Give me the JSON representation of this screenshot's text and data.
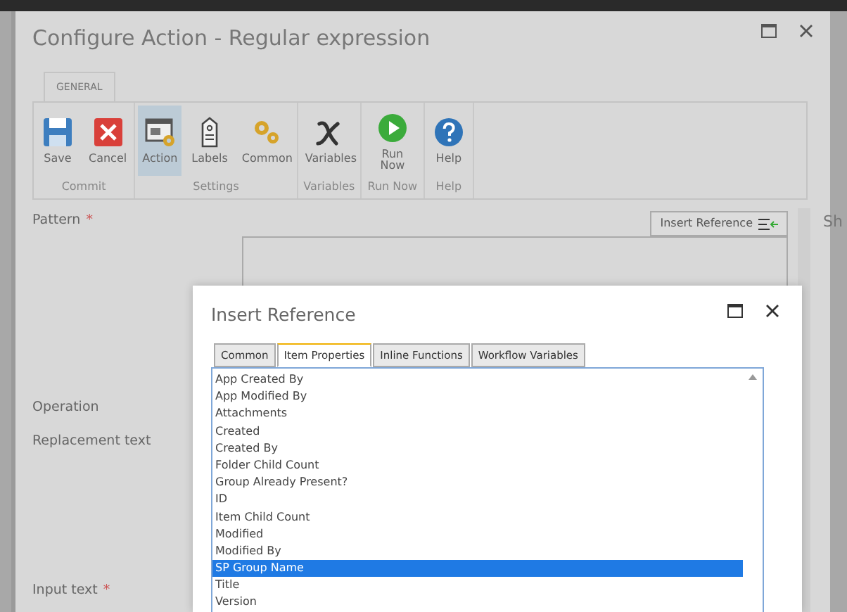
{
  "window": {
    "title": "Configure Action - Regular expression"
  },
  "ribbon": {
    "tabs": [
      {
        "label": "GENERAL",
        "selected": true
      }
    ],
    "groups": [
      {
        "label": "Commit",
        "buttons": [
          {
            "label": "Save",
            "kind": "save",
            "selected": false
          },
          {
            "label": "Cancel",
            "kind": "cancel",
            "selected": false
          }
        ]
      },
      {
        "label": "Settings",
        "buttons": [
          {
            "label": "Action",
            "kind": "action",
            "selected": true
          },
          {
            "label": "Labels",
            "kind": "labels",
            "selected": false
          },
          {
            "label": "Common",
            "kind": "common",
            "selected": false
          }
        ]
      },
      {
        "label": "Variables",
        "buttons": [
          {
            "label": "Variables",
            "kind": "variables",
            "selected": false
          }
        ]
      },
      {
        "label": "Run Now",
        "buttons": [
          {
            "label": "Run Now",
            "kind": "run",
            "selected": false
          }
        ]
      },
      {
        "label": "Help",
        "buttons": [
          {
            "label": "Help",
            "kind": "help",
            "selected": false
          }
        ]
      }
    ]
  },
  "form": {
    "insert_reference_button": "Insert Reference",
    "fields": [
      {
        "label": "Pattern",
        "required_mark": "*",
        "kind": "textarea"
      },
      {
        "label": "Operation",
        "kind": "plain"
      },
      {
        "label": "Replacement text",
        "kind": "plain"
      },
      {
        "label": "Input text",
        "required_mark": "*",
        "kind": "plain"
      }
    ]
  },
  "side_text": "Sh",
  "insert_reference": {
    "title": "Insert Reference",
    "tabs": [
      {
        "label": "Common",
        "selected": false
      },
      {
        "label": "Item Properties",
        "selected": true
      },
      {
        "label": "Inline Functions",
        "selected": false
      },
      {
        "label": "Workflow Variables",
        "selected": false
      }
    ],
    "items": [
      {
        "label": "App Created By",
        "selected": false
      },
      {
        "label": "App Modified By",
        "selected": false
      },
      {
        "label": "Attachments",
        "selected": false
      },
      {
        "label": "Created",
        "selected": false
      },
      {
        "label": "Created By",
        "selected": false
      },
      {
        "label": "Folder Child Count",
        "selected": false
      },
      {
        "label": "Group Already Present?",
        "selected": false
      },
      {
        "label": "ID",
        "selected": false
      },
      {
        "label": "Item Child Count",
        "selected": false
      },
      {
        "label": "Modified",
        "selected": false
      },
      {
        "label": "Modified By",
        "selected": false
      },
      {
        "label": "SP Group Name",
        "selected": true
      },
      {
        "label": "Title",
        "selected": false
      },
      {
        "label": "Version",
        "selected": false
      }
    ]
  }
}
